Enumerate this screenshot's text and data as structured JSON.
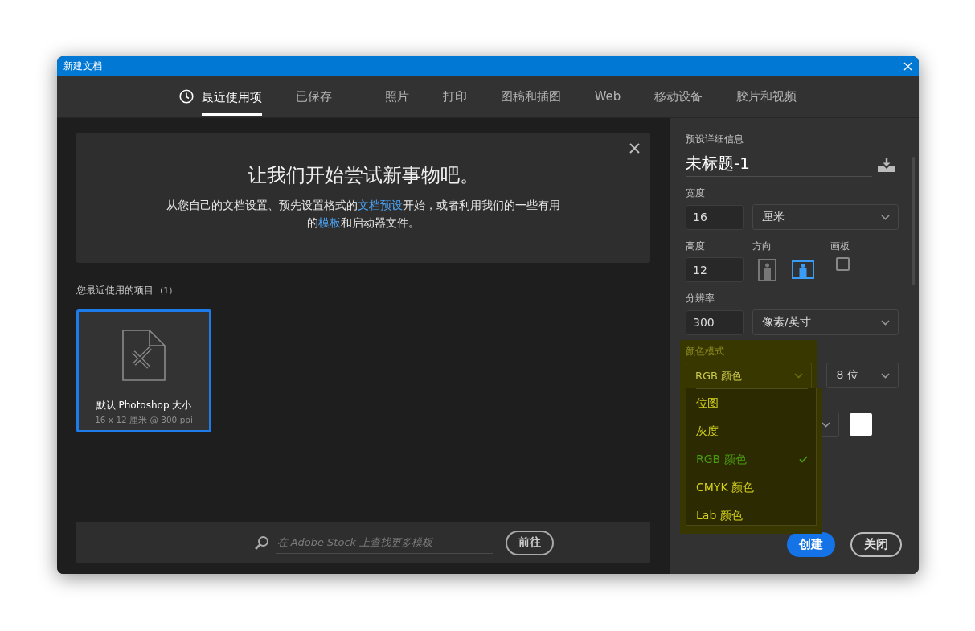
{
  "window": {
    "title": "新建文档"
  },
  "tabs": [
    {
      "label": "最近使用项",
      "selected": true,
      "has_icon": true,
      "divider_after": false
    },
    {
      "label": "已保存",
      "selected": false,
      "has_icon": false,
      "divider_after": true
    },
    {
      "label": "照片",
      "selected": false,
      "has_icon": false,
      "divider_after": false
    },
    {
      "label": "打印",
      "selected": false,
      "has_icon": false,
      "divider_after": false
    },
    {
      "label": "图稿和插图",
      "selected": false,
      "has_icon": false,
      "divider_after": false
    },
    {
      "label": "Web",
      "selected": false,
      "has_icon": false,
      "divider_after": false
    },
    {
      "label": "移动设备",
      "selected": false,
      "has_icon": false,
      "divider_after": false
    },
    {
      "label": "胶片和视频",
      "selected": false,
      "has_icon": false,
      "divider_after": false
    }
  ],
  "banner": {
    "title": "让我们开始尝试新事物吧。",
    "text_parts": [
      {
        "text": "从您自己的文档设置、预先设置格式的",
        "link": false
      },
      {
        "text": "文档预设",
        "link": true
      },
      {
        "text": "开始，或者利用我们的一些有用的",
        "link": false
      },
      {
        "text": "模板",
        "link": true
      },
      {
        "text": "和启动器文件。",
        "link": false
      }
    ]
  },
  "recent": {
    "heading": "您最近使用的项目",
    "count": "(1)",
    "items": [
      {
        "name": "默认 Photoshop 大小",
        "details": "16 x 12 厘米 @ 300 ppi",
        "selected": true
      }
    ]
  },
  "stock_search": {
    "placeholder": "在 Adobe Stock 上查找更多模板",
    "button": "前往"
  },
  "preset_details": {
    "heading": "预设详细信息",
    "name": "未标题-1",
    "width": {
      "label": "宽度",
      "value": "16",
      "unit": "厘米"
    },
    "height": {
      "label": "高度",
      "value": "12"
    },
    "orientation": {
      "label": "方向",
      "options": [
        {
          "kind": "portrait",
          "selected": false
        },
        {
          "kind": "landscape",
          "selected": true
        }
      ]
    },
    "artboard": {
      "label": "画板",
      "checked": false
    },
    "resolution": {
      "label": "分辨率",
      "value": "300",
      "unit": "像素/英寸"
    },
    "color_mode": {
      "label": "颜色模式",
      "value": "RGB 颜色",
      "expanded": true,
      "bit_depth": "8 位",
      "options": [
        {
          "label": "位图",
          "selected": false
        },
        {
          "label": "灰度",
          "selected": false
        },
        {
          "label": "RGB 颜色",
          "selected": true
        },
        {
          "label": "CMYK 颜色",
          "selected": false
        },
        {
          "label": "Lab 颜色",
          "selected": false
        }
      ]
    },
    "background": {
      "color": "#ffffff"
    }
  },
  "buttons": [
    {
      "label": "创建",
      "kind": "primary"
    },
    {
      "label": "关闭",
      "kind": "secondary"
    }
  ]
}
